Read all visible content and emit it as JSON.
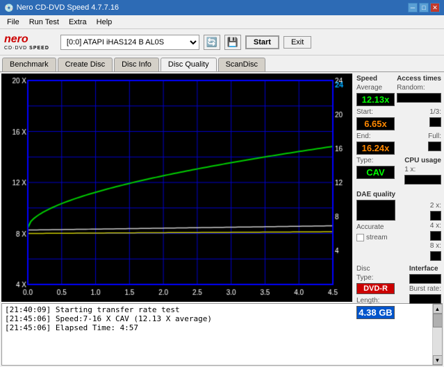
{
  "app": {
    "title": "Nero CD-DVD Speed 4.7.7.16",
    "icon": "💿"
  },
  "titlebar": {
    "minimize": "─",
    "maximize": "□",
    "close": "✕"
  },
  "menu": {
    "items": [
      "File",
      "Run Test",
      "Extra",
      "Help"
    ]
  },
  "toolbar": {
    "logo_main": "nero",
    "logo_sub": "CD·DVD SPEED",
    "drive_value": "[0:0]  ATAPI iHAS124  B AL0S",
    "start_label": "Start",
    "exit_label": "Exit"
  },
  "tabs": {
    "items": [
      "Benchmark",
      "Create Disc",
      "Disc Info",
      "Disc Quality",
      "ScanDisc"
    ],
    "active": "Disc Quality"
  },
  "chart": {
    "y_labels_left": [
      "20 X",
      "16 X",
      "12 X",
      "8 X",
      "4 X"
    ],
    "y_labels_right": [
      "24",
      "20",
      "16",
      "12",
      "8",
      "4"
    ],
    "x_labels": [
      "0.0",
      "0.5",
      "1.0",
      "1.5",
      "2.0",
      "2.5",
      "3.0",
      "3.5",
      "4.0",
      "4.5"
    ],
    "title": ""
  },
  "right_panel": {
    "speed_label": "Speed",
    "average_label": "Average",
    "average_value": "12.13x",
    "start_label": "Start:",
    "start_value": "6.65x",
    "end_label": "End:",
    "end_value": "16.24x",
    "type_label": "Type:",
    "type_value": "CAV",
    "access_label": "Access times",
    "random_label": "Random:",
    "one_third_label": "1/3:",
    "full_label": "Full:",
    "cpu_label": "CPU usage",
    "cpu_1x_label": "1 x:",
    "cpu_2x_label": "2 x:",
    "cpu_4x_label": "4 x:",
    "cpu_8x_label": "8 x:",
    "dae_label": "DAE quality",
    "accurate_label": "Accurate",
    "stream_label": "stream",
    "disc_type_label": "Disc",
    "disc_type_sub": "Type:",
    "disc_type_value": "DVD-R",
    "disc_length_label": "Length:",
    "disc_length_value": "4.38 GB",
    "interface_label": "Interface",
    "burst_label": "Burst rate:"
  },
  "log": {
    "lines": [
      "[21:40:09]  Starting transfer rate test",
      "[21:45:06]  Speed:7-16 X CAV (12.13 X average)",
      "[21:45:06]  Elapsed Time: 4:57"
    ]
  },
  "colors": {
    "accent_blue": "#2d6bb5",
    "chart_bg": "#000000",
    "grid_blue": "#0000cc",
    "line_green": "#00cc00",
    "line_yellow": "#cccc00",
    "line_white": "#ffffff"
  }
}
